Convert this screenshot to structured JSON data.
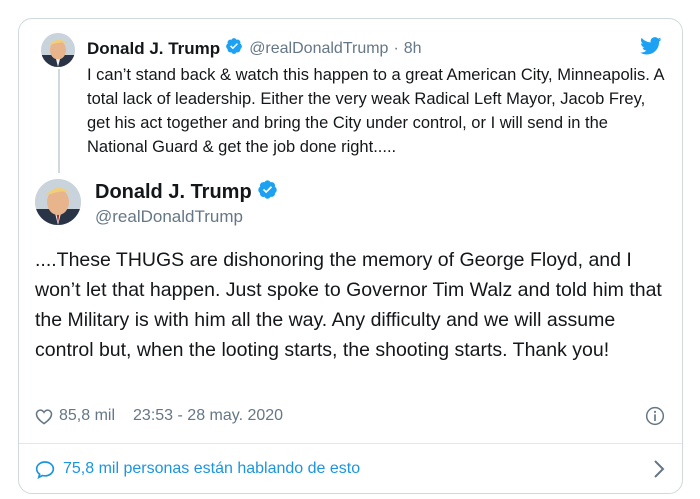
{
  "colors": {
    "link_blue": "#1b95e0",
    "muted": "#657786",
    "text": "#14171a",
    "border": "#cfd9de"
  },
  "parent_tweet": {
    "name": "Donald J. Trump",
    "handle": "@realDonaldTrump",
    "separator": "·",
    "time": "8h",
    "text": "I can’t stand back & watch this happen to a great American City, Minneapolis. A total lack of leadership. Either the very weak Radical Left Mayor, Jacob Frey, get his act together and bring the City under control, or I will send in the National Guard & get the job done right.....",
    "icons": {
      "avatar": "avatar",
      "verified": "verified-badge-icon",
      "brand": "twitter-bird-icon"
    }
  },
  "main_tweet": {
    "name": "Donald J. Trump",
    "handle": "@realDonaldTrump",
    "text": "....These THUGS are dishonoring the memory of George Floyd, and I won’t let that happen. Just spoke to Governor Tim Walz and told him that the Military is with him all the way. Any difficulty and we will assume control but, when the looting starts, the shooting starts. Thank you!",
    "likes": "85,8 mil",
    "timestamp": "23:53 - 28 may. 2020",
    "icons": {
      "like": "heart-icon",
      "info": "info-icon"
    }
  },
  "footer": {
    "conversation_label": "75,8 mil personas están hablando de esto",
    "icons": {
      "conversation": "comment-bubble-icon",
      "more": "chevron-right-icon"
    }
  }
}
